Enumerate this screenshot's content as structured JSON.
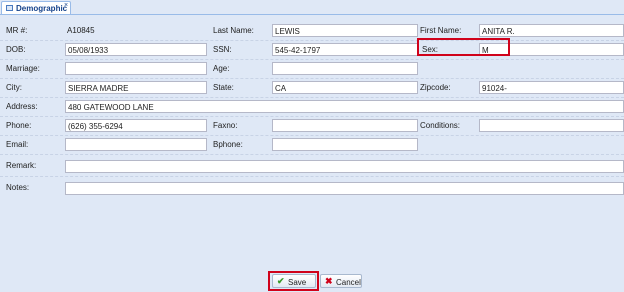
{
  "tab": {
    "title": "Demographic",
    "close_glyph": "×",
    "icon": "form-icon"
  },
  "fields": {
    "mr": {
      "label": "MR #:",
      "value": "A10845"
    },
    "last_name": {
      "label": "Last Name:",
      "value": "LEWIS"
    },
    "first_name": {
      "label": "First Name:",
      "value": "ANITA R."
    },
    "dob": {
      "label": "DOB:",
      "value": "05/08/1933"
    },
    "ssn": {
      "label": "SSN:",
      "value": "545-42-1797"
    },
    "sex": {
      "label": "Sex:",
      "value": "M"
    },
    "marriage": {
      "label": "Marriage:",
      "value": ""
    },
    "age": {
      "label": "Age:",
      "value": ""
    },
    "city": {
      "label": "City:",
      "value": "SIERRA MADRE"
    },
    "state": {
      "label": "State:",
      "value": "CA"
    },
    "zipcode": {
      "label": "Zipcode:",
      "value": "91024-"
    },
    "address": {
      "label": "Address:",
      "value": "480 GATEWOOD LANE"
    },
    "phone": {
      "label": "Phone:",
      "value": "(626) 355-6294"
    },
    "faxno": {
      "label": "Faxno:",
      "value": ""
    },
    "conditions": {
      "label": "Conditions:",
      "value": ""
    },
    "email": {
      "label": "Email:",
      "value": ""
    },
    "bphone": {
      "label": "Bphone:",
      "value": ""
    },
    "remark": {
      "label": "Remark:",
      "value": ""
    },
    "notes": {
      "label": "Notes:",
      "value": ""
    }
  },
  "buttons": {
    "save": {
      "label": "Save",
      "icon": "checkmark-icon",
      "color": "#3a9a2a"
    },
    "cancel": {
      "label": "Cancel",
      "icon": "x-icon",
      "color": "#d0021b"
    }
  },
  "colors": {
    "panel": "#dfe8f6",
    "highlight": "#d0021b",
    "tab_text": "#15428b"
  }
}
